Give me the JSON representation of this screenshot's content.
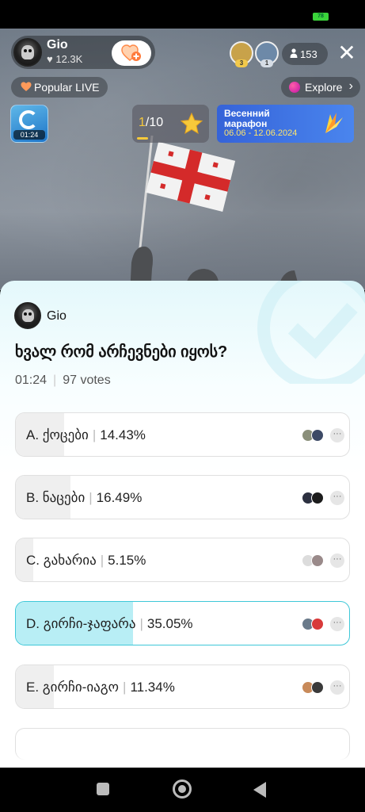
{
  "status_bar": {
    "battery": "78"
  },
  "host": {
    "name": "Gio",
    "likes": "12.3K",
    "follow_icon": "heart-plus-icon"
  },
  "top_viewers": [
    {
      "badge": "3",
      "badge_color": "#f3c94a",
      "avatar_color": "#c8a24a"
    },
    {
      "badge": "1",
      "badge_color": "#d6dde6",
      "avatar_color": "#6d89a8"
    }
  ],
  "viewer_count": "153",
  "popular_label": "Popular LIVE",
  "explore_label": "Explore",
  "game": {
    "timer": "01:24"
  },
  "rank": {
    "current": "1",
    "total": "/10"
  },
  "marathon": {
    "line1": "Весенний",
    "line2": "марафон",
    "dates": "06.06 - 12.06.2024"
  },
  "poll": {
    "creator": "Gio",
    "question": "ხვალ რომ არჩევნები იყოს?",
    "time": "01:24",
    "votes": "97 votes",
    "options": [
      {
        "label": "A. ქოცები",
        "percent": "14.43%",
        "value": 14.43,
        "selected": false
      },
      {
        "label": "B. ნაცები",
        "percent": "16.49%",
        "value": 16.49,
        "selected": false
      },
      {
        "label": "C. გახარია",
        "percent": "5.15%",
        "value": 5.15,
        "selected": false
      },
      {
        "label": "D. გირჩი-ჯაფარა",
        "percent": "35.05%",
        "value": 35.05,
        "selected": true
      },
      {
        "label": "E. გირჩი-იაგო",
        "percent": "11.34%",
        "value": 11.34,
        "selected": false
      }
    ]
  },
  "colors": {
    "accent": "#3fc8d8",
    "selected_fill": "#b8eef5",
    "bar_fill": "#efefef",
    "marathon": "#3a6fe0"
  }
}
